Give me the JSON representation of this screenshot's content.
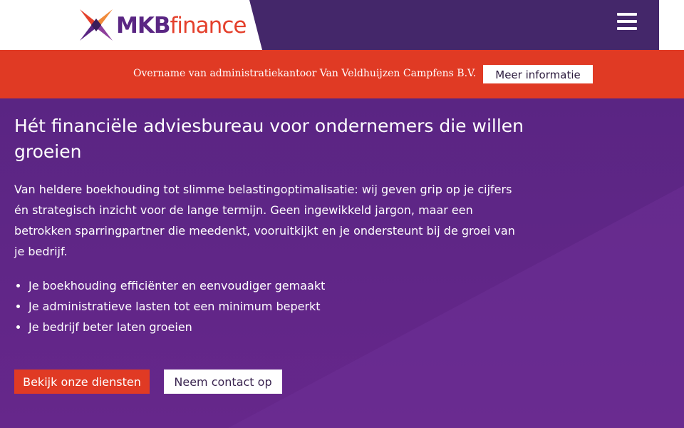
{
  "header": {
    "logo": {
      "brand_bold": "MKB",
      "brand_light": "finance"
    },
    "menu_icon": "hamburger-menu-icon"
  },
  "banner": {
    "text": "Overname van administratiekantoor Van Veldhuijzen Campfens B.V.",
    "button_label": "Meer informatie"
  },
  "hero": {
    "title": "Hét financiële adviesbureau voor ondernemers die willen groeien",
    "description": "Van heldere boekhouding tot slimme belastingoptimalisatie: wij geven grip op je cijfers én strategisch inzicht voor de lange termijn. Geen ingewikkeld jargon, maar een betrokken sparringpartner die meedenkt, vooruitkijkt en je ondersteunt bij de groei van je bedrijf.",
    "bullets": [
      "Je boekhouding efficiënter en eenvoudiger gemaakt",
      "Je administratieve lasten tot een minimum beperkt",
      "Je bedrijf beter laten groeien"
    ],
    "primary_button": "Bekijk onze diensten",
    "secondary_button": "Neem contact op"
  },
  "colors": {
    "brand_purple": "#5a2683",
    "header_purple": "#44276a",
    "accent_red": "#e03a24",
    "white": "#ffffff"
  }
}
